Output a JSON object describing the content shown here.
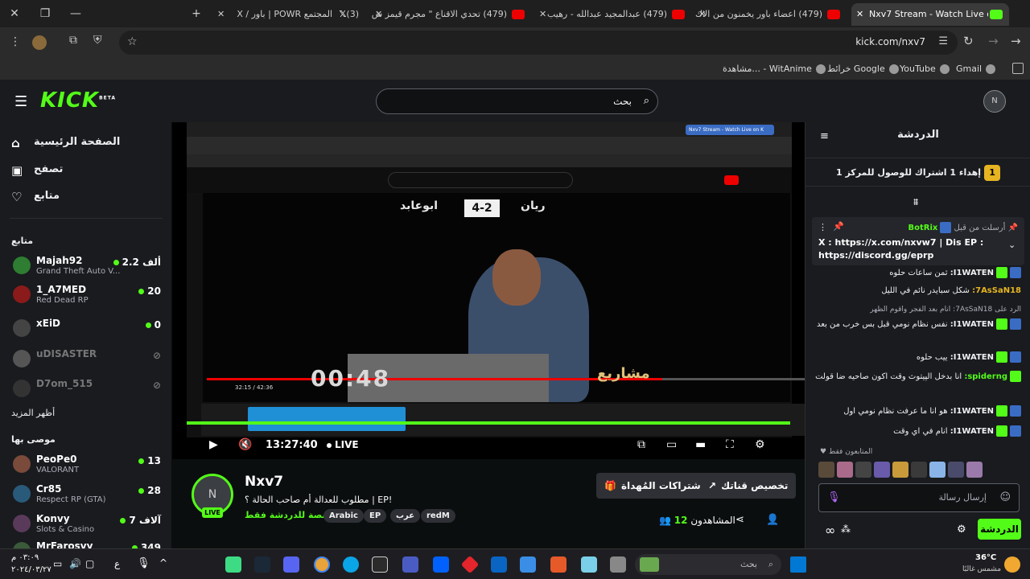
{
  "browser": {
    "tabs": [
      {
        "label": "Nxv7 Stream - Watch Live on Kick",
        "active": true
      },
      {
        "label": "(479) اعضاء باور يخمنون من الاك",
        "active": false
      },
      {
        "label": "(479) عبدالمجيد عبدالله - رهيب",
        "active": false
      },
      {
        "label": "(479) تحدي الاقناع \" مجرم قيمز ش",
        "active": false
      },
      {
        "label": "(3) المجتمع POWR | باور / X",
        "active": false
      }
    ],
    "url": "kick.com/nxv7",
    "bookmarks": [
      "Gmail",
      "YouTube",
      "خرائط Google",
      "مشاهدة... - WitAnime"
    ]
  },
  "header": {
    "logo": "KICK",
    "logo_sup": "BETA",
    "search_placeholder": "بحث",
    "profile_initials": "N"
  },
  "sidebar": {
    "nav": [
      {
        "label": "الصفحة الرئيسية",
        "icon": "home-icon"
      },
      {
        "label": "تصفح",
        "icon": "browse-icon"
      },
      {
        "label": "متابع",
        "icon": "heart-icon"
      }
    ],
    "following_title": "متابع",
    "following": [
      {
        "name": "Majah92",
        "category": "Grand Theft Auto V...",
        "count": "2.2 ألف",
        "live": true,
        "color": "#2e7d32"
      },
      {
        "name": "1_A7MED",
        "category": "Red Dead RP",
        "count": "20",
        "live": true,
        "color": "#8b1a1a"
      },
      {
        "name": "xEiD",
        "category": "",
        "count": "0",
        "live": true,
        "color": "#444444"
      },
      {
        "name": "uDISASTER",
        "category": "",
        "count": "",
        "live": false,
        "color": "#555555"
      },
      {
        "name": "D7om_515",
        "category": "",
        "count": "",
        "live": false,
        "color": "#333333"
      }
    ],
    "show_more": "أظهر المزيد",
    "recommended_title": "موصى بها",
    "recommended": [
      {
        "name": "PeoPe0",
        "category": "VALORANT",
        "count": "13",
        "color": "#7a4a3a"
      },
      {
        "name": "Cr85",
        "category": "Respect RP (GTA)",
        "count": "28",
        "color": "#2a5a7a"
      },
      {
        "name": "Konvy",
        "category": "Slots & Casino",
        "count": "7 آلاف",
        "color": "#5a3a5a"
      },
      {
        "name": "MrFarosvy",
        "category": "",
        "count": "349",
        "color": "#3a5a3a"
      }
    ]
  },
  "video": {
    "inner_tabs": "Nxv7 Stream - Watch Live on K",
    "team_left": "ابوعابد",
    "team_right": "ريان",
    "score": "4-2",
    "timer": "00:48",
    "brand": "مشاريع",
    "inner_time": "32:15 / 42:36",
    "live_time": "13:27:40",
    "live_label": "LIVE",
    "progress": 0.76
  },
  "stream": {
    "name": "Nxv7",
    "avatar_initials": "N",
    "live_badge": "LIVE",
    "title": "مطلوب للعدالة أم صاحب الحالة ؟ | EP!",
    "category": "مخصصة للدردشة فقط",
    "tags": [
      "redM",
      "عرب",
      "EP",
      "Arabic"
    ],
    "gift_button": "الاشتراكات المُهداة",
    "customize_button": "تخصيص قناتك",
    "viewers_label": "المشاهدون",
    "viewers_count": "12"
  },
  "chat": {
    "title": "الدردشة",
    "goal": "إهداء 1 اشتراك للوصول للمركز 1",
    "goal_rank": "1",
    "pinned_user": "BotRix",
    "pinned_meta": "أرسلت من قبل",
    "pinned_text": "X : https://x.com/nxvw7 | Dis EP : https://discord.gg/eprp",
    "messages": [
      {
        "user": "I1WATEN:",
        "text": "ثمن ساعات حلوه",
        "color": "#efeff1"
      },
      {
        "user": "7AsSaN18:",
        "text": "شكل سبايدر نائم في الليل",
        "color": "#e6b422"
      },
      {
        "user": "",
        "text": "الرد على 7AsSaN18: انام بعد الفجر واقوم الظهر",
        "color": "#adadb8"
      },
      {
        "user": "I1WATEN:",
        "text": "نفس نظام نومي قبل بس خرب من بعد",
        "color": "#efeff1"
      },
      {
        "user": "I1WATEN:",
        "text": "ييب حلوه",
        "color": "#efeff1"
      },
      {
        "user": "spiderng:",
        "text": "انا بدخل الپيتوث وقت اكون صاحيه ضا قولت",
        "color": "#53fc18"
      },
      {
        "user": "I1WATEN:",
        "text": "هو انا ما عرفت نظام نومي اول",
        "color": "#efeff1"
      },
      {
        "user": "I1WATEN:",
        "text": "انام في اي وقت",
        "color": "#efeff1"
      }
    ],
    "followers_only": "المتابعون فقط",
    "input_placeholder": "إرسال رسالة",
    "send_button": "الدردشة"
  },
  "taskbar": {
    "search_placeholder": "بحث",
    "weather_temp": "36°C",
    "weather_desc": "مشمس غالبًا",
    "time": "٠٣:٠٩ م",
    "date": "٢٠٢٤/٠٣/٢٧",
    "lang": "ع"
  },
  "colors": {
    "kick_green": "#53fc18",
    "panel": "#191b1f",
    "background": "#0b0e0f"
  }
}
